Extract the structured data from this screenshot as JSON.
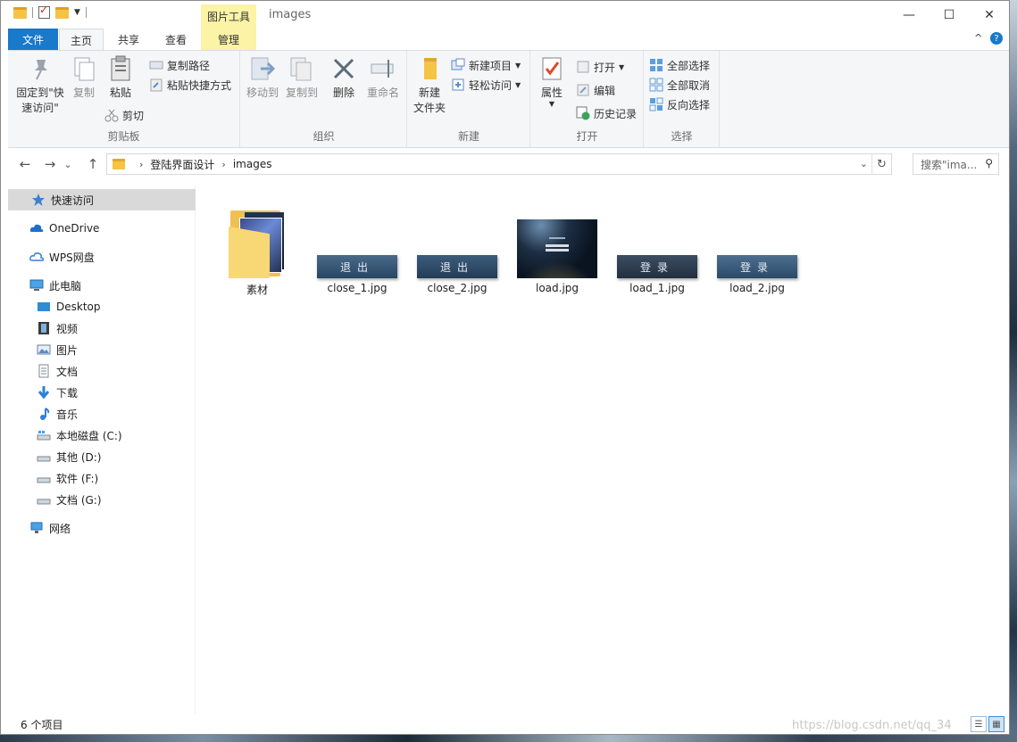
{
  "titlebar": {
    "context_tool": "图片工具",
    "title": "images",
    "controls": {
      "minimize": "—",
      "maximize": "☐",
      "close": "✕"
    }
  },
  "tabs": {
    "file": "文件",
    "home": "主页",
    "share": "共享",
    "view": "查看",
    "manage": "管理",
    "collapse": "^",
    "help": "?"
  },
  "ribbon": {
    "clipboard": {
      "label": "剪贴板",
      "pin": "固定到\"快速访问\"",
      "pin_line1": "固定到\"快",
      "pin_line2": "速访问\"",
      "copy": "复制",
      "paste": "粘贴",
      "copy_path": "复制路径",
      "paste_shortcut": "粘贴快捷方式",
      "cut": "剪切"
    },
    "organize": {
      "label": "组织",
      "move_to": "移动到",
      "copy_to": "复制到",
      "delete": "删除",
      "rename": "重命名"
    },
    "new": {
      "label": "新建",
      "new_folder_line1": "新建",
      "new_folder_line2": "文件夹",
      "new_item": "新建项目",
      "easy_access": "轻松访问"
    },
    "open": {
      "label": "打开",
      "properties": "属性",
      "open": "打开",
      "edit": "编辑",
      "history": "历史记录"
    },
    "select": {
      "label": "选择",
      "select_all": "全部选择",
      "select_none": "全部取消",
      "invert": "反向选择"
    }
  },
  "navbar": {
    "back": "←",
    "forward": "→",
    "recent": "⌄",
    "up": "↑",
    "breadcrumb": [
      "登陆界面设计",
      "images"
    ],
    "search_placeholder": "搜索\"ima...",
    "refresh": "↻"
  },
  "sidebar": {
    "items": [
      {
        "label": "快速访问",
        "icon": "star-icon"
      },
      {
        "label": "OneDrive",
        "icon": "cloud-icon"
      },
      {
        "label": "WPS网盘",
        "icon": "wps-cloud-icon"
      },
      {
        "label": "此电脑",
        "icon": "pc-icon"
      },
      {
        "label": "Desktop",
        "icon": "desktop-icon"
      },
      {
        "label": "视频",
        "icon": "video-icon"
      },
      {
        "label": "图片",
        "icon": "picture-icon"
      },
      {
        "label": "文档",
        "icon": "document-icon"
      },
      {
        "label": "下载",
        "icon": "download-icon"
      },
      {
        "label": "音乐",
        "icon": "music-icon"
      },
      {
        "label": "本地磁盘 (C:)",
        "icon": "drive-icon"
      },
      {
        "label": "其他 (D:)",
        "icon": "drive-icon"
      },
      {
        "label": "软件 (F:)",
        "icon": "drive-icon"
      },
      {
        "label": "文档 (G:)",
        "icon": "drive-icon"
      },
      {
        "label": "网络",
        "icon": "network-icon"
      }
    ]
  },
  "files": [
    {
      "name": "素材",
      "type": "folder"
    },
    {
      "name": "close_1.jpg",
      "type": "image",
      "thumb_text": "退出"
    },
    {
      "name": "close_2.jpg",
      "type": "image",
      "thumb_text": "退出"
    },
    {
      "name": "load.jpg",
      "type": "image"
    },
    {
      "name": "load_1.jpg",
      "type": "image",
      "thumb_text": "登录"
    },
    {
      "name": "load_2.jpg",
      "type": "image",
      "thumb_text": "登录"
    }
  ],
  "status": {
    "count": "6 个项目",
    "watermark": "https://blog.csdn.net/qq_34"
  },
  "colors": {
    "accent": "#1979ca",
    "context_tab": "#fbf3a6",
    "selected_nav": "#d9d9d9"
  }
}
